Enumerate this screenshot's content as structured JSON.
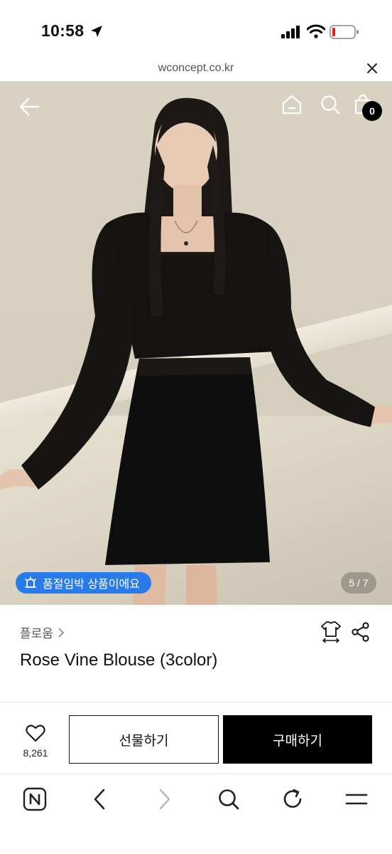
{
  "status": {
    "time": "10:58"
  },
  "browser": {
    "url": "wconcept.co.kr"
  },
  "hero": {
    "cart_count": "0",
    "sellout_badge": "품절임박 상품이에요",
    "image_counter": "5 / 7",
    "image_index": 5,
    "image_total": 7
  },
  "product": {
    "brand": "플로움",
    "title": "Rose Vine Blouse (3color)"
  },
  "actions": {
    "like_count": "8,261",
    "gift_label": "선물하기",
    "buy_label": "구매하기"
  },
  "colors": {
    "accent_blue": "#2a7bea",
    "black": "#000000"
  }
}
